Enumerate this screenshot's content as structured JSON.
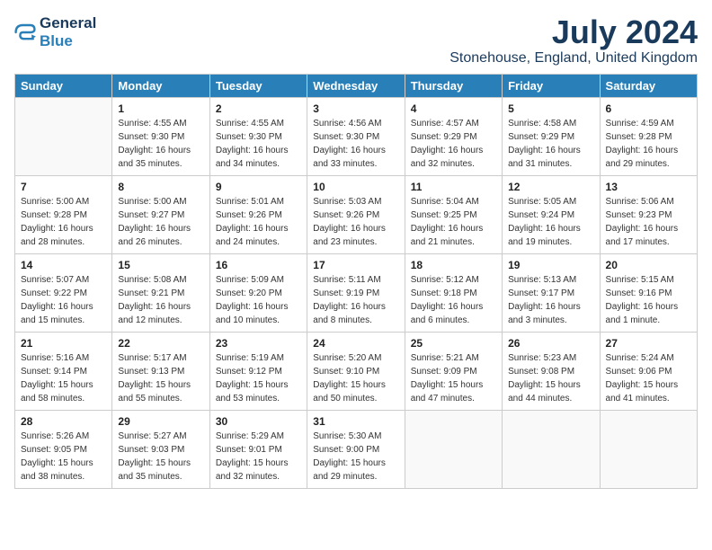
{
  "header": {
    "logo_line1": "General",
    "logo_line2": "Blue",
    "month": "July 2024",
    "location": "Stonehouse, England, United Kingdom"
  },
  "days_of_week": [
    "Sunday",
    "Monday",
    "Tuesday",
    "Wednesday",
    "Thursday",
    "Friday",
    "Saturday"
  ],
  "weeks": [
    [
      {
        "num": "",
        "info": ""
      },
      {
        "num": "1",
        "info": "Sunrise: 4:55 AM\nSunset: 9:30 PM\nDaylight: 16 hours\nand 35 minutes."
      },
      {
        "num": "2",
        "info": "Sunrise: 4:55 AM\nSunset: 9:30 PM\nDaylight: 16 hours\nand 34 minutes."
      },
      {
        "num": "3",
        "info": "Sunrise: 4:56 AM\nSunset: 9:30 PM\nDaylight: 16 hours\nand 33 minutes."
      },
      {
        "num": "4",
        "info": "Sunrise: 4:57 AM\nSunset: 9:29 PM\nDaylight: 16 hours\nand 32 minutes."
      },
      {
        "num": "5",
        "info": "Sunrise: 4:58 AM\nSunset: 9:29 PM\nDaylight: 16 hours\nand 31 minutes."
      },
      {
        "num": "6",
        "info": "Sunrise: 4:59 AM\nSunset: 9:28 PM\nDaylight: 16 hours\nand 29 minutes."
      }
    ],
    [
      {
        "num": "7",
        "info": "Sunrise: 5:00 AM\nSunset: 9:28 PM\nDaylight: 16 hours\nand 28 minutes."
      },
      {
        "num": "8",
        "info": "Sunrise: 5:00 AM\nSunset: 9:27 PM\nDaylight: 16 hours\nand 26 minutes."
      },
      {
        "num": "9",
        "info": "Sunrise: 5:01 AM\nSunset: 9:26 PM\nDaylight: 16 hours\nand 24 minutes."
      },
      {
        "num": "10",
        "info": "Sunrise: 5:03 AM\nSunset: 9:26 PM\nDaylight: 16 hours\nand 23 minutes."
      },
      {
        "num": "11",
        "info": "Sunrise: 5:04 AM\nSunset: 9:25 PM\nDaylight: 16 hours\nand 21 minutes."
      },
      {
        "num": "12",
        "info": "Sunrise: 5:05 AM\nSunset: 9:24 PM\nDaylight: 16 hours\nand 19 minutes."
      },
      {
        "num": "13",
        "info": "Sunrise: 5:06 AM\nSunset: 9:23 PM\nDaylight: 16 hours\nand 17 minutes."
      }
    ],
    [
      {
        "num": "14",
        "info": "Sunrise: 5:07 AM\nSunset: 9:22 PM\nDaylight: 16 hours\nand 15 minutes."
      },
      {
        "num": "15",
        "info": "Sunrise: 5:08 AM\nSunset: 9:21 PM\nDaylight: 16 hours\nand 12 minutes."
      },
      {
        "num": "16",
        "info": "Sunrise: 5:09 AM\nSunset: 9:20 PM\nDaylight: 16 hours\nand 10 minutes."
      },
      {
        "num": "17",
        "info": "Sunrise: 5:11 AM\nSunset: 9:19 PM\nDaylight: 16 hours\nand 8 minutes."
      },
      {
        "num": "18",
        "info": "Sunrise: 5:12 AM\nSunset: 9:18 PM\nDaylight: 16 hours\nand 6 minutes."
      },
      {
        "num": "19",
        "info": "Sunrise: 5:13 AM\nSunset: 9:17 PM\nDaylight: 16 hours\nand 3 minutes."
      },
      {
        "num": "20",
        "info": "Sunrise: 5:15 AM\nSunset: 9:16 PM\nDaylight: 16 hours\nand 1 minute."
      }
    ],
    [
      {
        "num": "21",
        "info": "Sunrise: 5:16 AM\nSunset: 9:14 PM\nDaylight: 15 hours\nand 58 minutes."
      },
      {
        "num": "22",
        "info": "Sunrise: 5:17 AM\nSunset: 9:13 PM\nDaylight: 15 hours\nand 55 minutes."
      },
      {
        "num": "23",
        "info": "Sunrise: 5:19 AM\nSunset: 9:12 PM\nDaylight: 15 hours\nand 53 minutes."
      },
      {
        "num": "24",
        "info": "Sunrise: 5:20 AM\nSunset: 9:10 PM\nDaylight: 15 hours\nand 50 minutes."
      },
      {
        "num": "25",
        "info": "Sunrise: 5:21 AM\nSunset: 9:09 PM\nDaylight: 15 hours\nand 47 minutes."
      },
      {
        "num": "26",
        "info": "Sunrise: 5:23 AM\nSunset: 9:08 PM\nDaylight: 15 hours\nand 44 minutes."
      },
      {
        "num": "27",
        "info": "Sunrise: 5:24 AM\nSunset: 9:06 PM\nDaylight: 15 hours\nand 41 minutes."
      }
    ],
    [
      {
        "num": "28",
        "info": "Sunrise: 5:26 AM\nSunset: 9:05 PM\nDaylight: 15 hours\nand 38 minutes."
      },
      {
        "num": "29",
        "info": "Sunrise: 5:27 AM\nSunset: 9:03 PM\nDaylight: 15 hours\nand 35 minutes."
      },
      {
        "num": "30",
        "info": "Sunrise: 5:29 AM\nSunset: 9:01 PM\nDaylight: 15 hours\nand 32 minutes."
      },
      {
        "num": "31",
        "info": "Sunrise: 5:30 AM\nSunset: 9:00 PM\nDaylight: 15 hours\nand 29 minutes."
      },
      {
        "num": "",
        "info": ""
      },
      {
        "num": "",
        "info": ""
      },
      {
        "num": "",
        "info": ""
      }
    ]
  ]
}
